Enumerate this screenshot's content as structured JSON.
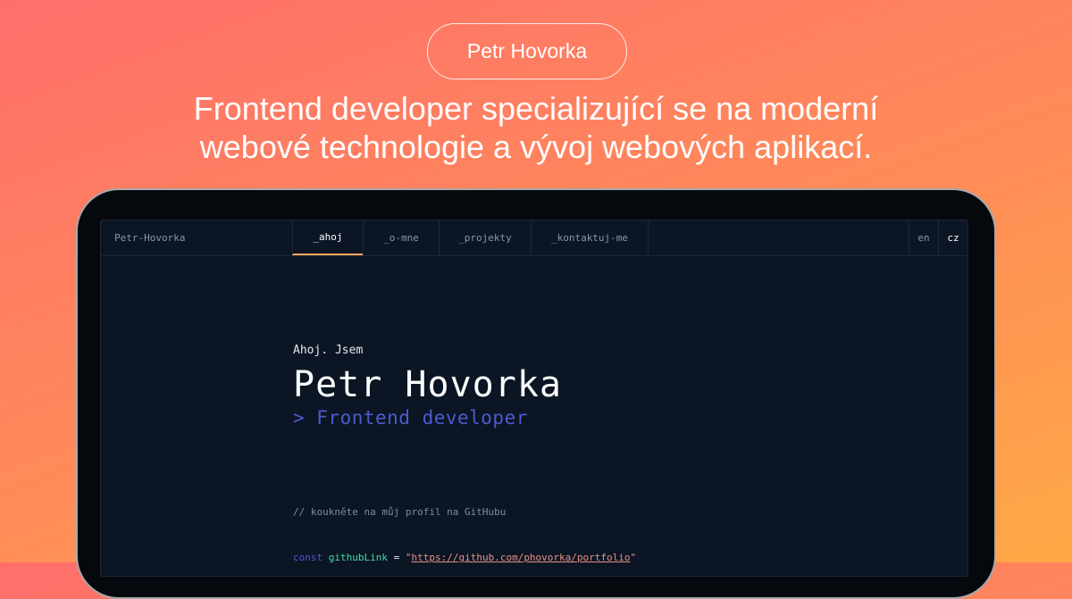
{
  "hero": {
    "name_pill": "Petr Hovorka",
    "tagline_line1": "Frontend developer specializující se na moderní",
    "tagline_line2": "webové technologie a vývoj webových aplikací."
  },
  "screen": {
    "brand": "Petr-Hovorka",
    "tabs": [
      {
        "label": "_ahoj",
        "active": true
      },
      {
        "label": "_o-mne",
        "active": false
      },
      {
        "label": "_projekty",
        "active": false
      },
      {
        "label": "_kontaktuj-me",
        "active": false
      }
    ],
    "languages": [
      {
        "label": "en",
        "active": false
      },
      {
        "label": "cz",
        "active": true
      }
    ],
    "intro": {
      "greeting": "Ahoj. Jsem",
      "name": "Petr Hovorka",
      "role": "> Frontend developer"
    },
    "code": {
      "comment": "// koukněte na můj profil na GitHubu",
      "keyword": "const",
      "variable": "githubLink",
      "operator": "=",
      "quote": "\"",
      "link": "https://github.com/phovorka/portfolio"
    }
  },
  "colors": {
    "gradient_start": "#fe6f6c",
    "gradient_end": "#ffa946",
    "screen_bg": "#0b1524",
    "accent_tab": "#fea55f",
    "role_text": "#4d5bce",
    "variable": "#43d9ad",
    "string": "#e99287"
  }
}
